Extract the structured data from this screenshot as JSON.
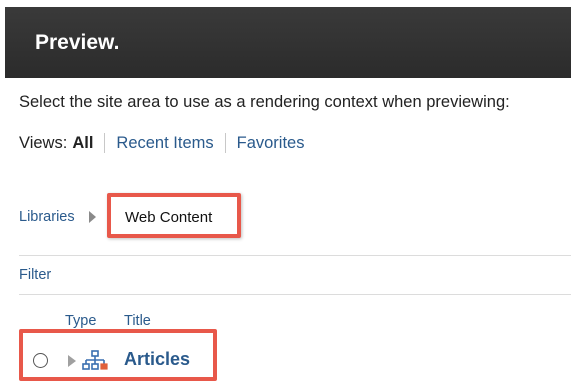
{
  "header": {
    "title": "Preview."
  },
  "instruction": "Select the site area to use as a rendering context when previewing:",
  "views": {
    "label": "Views:",
    "all": "All",
    "recent": "Recent Items",
    "favorites": "Favorites"
  },
  "breadcrumb": {
    "libraries": "Libraries",
    "current": "Web Content"
  },
  "filter": "Filter",
  "columns": {
    "type": "Type",
    "title": "Title"
  },
  "rows": [
    {
      "title": "Articles",
      "type_icon": "sitemap-icon"
    }
  ],
  "colors": {
    "header_bg": "#2b2b2b",
    "link": "#2a5a8c",
    "highlight": "#e8584a",
    "icon_blue": "#3a6fb0",
    "icon_orange": "#e0603a"
  }
}
